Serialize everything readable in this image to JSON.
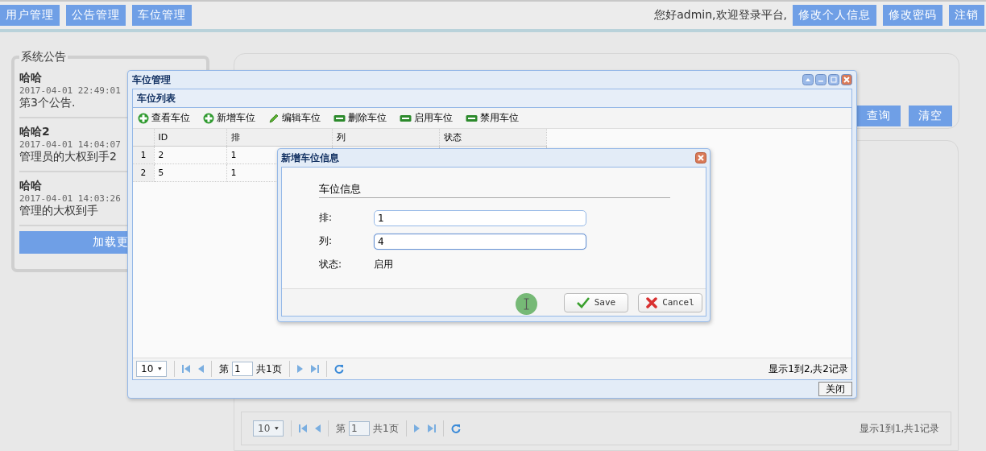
{
  "top_nav": {
    "menu": [
      "用户管理",
      "公告管理",
      "车位管理"
    ],
    "greeting": "您好admin,欢迎登录平台,",
    "actions": [
      "修改个人信息",
      "修改密码",
      "注销"
    ]
  },
  "notice_panel": {
    "title": "系统公告",
    "notices": [
      {
        "title": "哈哈",
        "time": "2017-04-01 22:49:01",
        "content": "第3个公告."
      },
      {
        "title": "哈哈2",
        "time": "2017-04-01 14:04:07",
        "content": "管理员的大权到手2"
      },
      {
        "title": "哈哈",
        "time": "2017-04-01 14:03:26",
        "content": "管理的大权到手"
      }
    ],
    "load_more": "加载更"
  },
  "search_panel": {
    "buttons": [
      "查询",
      "清空"
    ]
  },
  "background_pager": {
    "page_size": "10",
    "page_label": "第",
    "page": "1",
    "total_pages": "共1页",
    "summary": "显示1到1,共1记录"
  },
  "window": {
    "title": "车位管理",
    "panel_title": "车位列表",
    "toolbar": [
      {
        "label": "查看车位",
        "kind": "add"
      },
      {
        "label": "新增车位",
        "kind": "add"
      },
      {
        "label": "编辑车位",
        "kind": "edit"
      },
      {
        "label": "删除车位",
        "kind": "bar"
      },
      {
        "label": "启用车位",
        "kind": "bar"
      },
      {
        "label": "禁用车位",
        "kind": "bar"
      }
    ],
    "columns": [
      "ID",
      "排",
      "列",
      "状态"
    ],
    "rows": [
      {
        "number": "1",
        "cells": [
          "2",
          "1"
        ]
      },
      {
        "number": "2",
        "cells": [
          "5",
          "1"
        ]
      }
    ],
    "pager": {
      "page_size": "10",
      "page_label": "第",
      "page": "1",
      "total_pages": "共1页",
      "summary": "显示1到2,共2记录"
    },
    "close_button": "关闭"
  },
  "dialog": {
    "title": "新增车位信息",
    "section": "车位信息",
    "fields": [
      {
        "label": "排:",
        "value": "1",
        "kind": "input",
        "focused": false
      },
      {
        "label": "列:",
        "value": "4",
        "kind": "input",
        "focused": true
      },
      {
        "label": "状态:",
        "value": "启用",
        "kind": "text"
      }
    ],
    "buttons": [
      {
        "label": "Save",
        "kind": "save"
      },
      {
        "label": "Cancel",
        "kind": "cancel"
      }
    ]
  }
}
